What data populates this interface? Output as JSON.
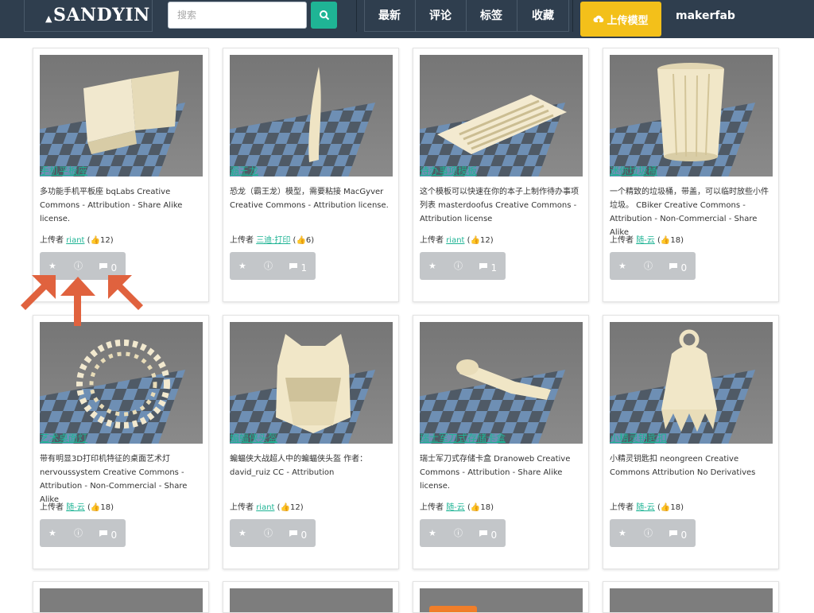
{
  "header": {
    "logo": "SANDYIN",
    "search_placeholder": "搜索",
    "nav": [
      "最新",
      "评论",
      "标签",
      "收藏"
    ],
    "upload_label": "上传模型",
    "makerfab_label": "makerfab"
  },
  "cards": [
    {
      "title": "手机平板座",
      "desc": "多功能手机平板座 bqLabs Creative Commons - Attribution - Share Alike license.",
      "uploader_label": "上传者",
      "uploader": "riant",
      "likes": "12",
      "star": "★",
      "info": "ⓘ",
      "comments": "0",
      "color": "#f3e9c9"
    },
    {
      "title": "霸王龙",
      "desc": "恐龙（霸王龙）模型，需要粘接 MacGyver Creative Commons - Attribution license.",
      "uploader_label": "上传者",
      "uploader": "三迪·打印",
      "likes": "6",
      "star": "★",
      "info": "ⓘ",
      "comments": "1",
      "color": "#f3e9c9"
    },
    {
      "title": "待办事项模板",
      "desc": "这个模板可以快速在你的本子上制作待办事项列表 masterdoofus Creative Commons - Attribution license",
      "uploader_label": "上传者",
      "uploader": "riant",
      "likes": "12",
      "star": "★",
      "info": "ⓘ",
      "comments": "1",
      "color": "#f3e9c9"
    },
    {
      "title": "迷你垃圾桶",
      "desc": "一个精致的垃圾桶，带盖，可以临时放些小件垃圾。 CBiker Creative Commons - Attribution - Non-Commercial - Share Alike",
      "uploader_label": "上传者",
      "uploader": "随-云",
      "likes": "18",
      "star": "★",
      "info": "ⓘ",
      "comments": "0",
      "color": "#f3e9c9"
    },
    {
      "title": "艺术桌面灯",
      "desc": "带有明显3D打印机特征的桌面艺术灯 nervoussystem Creative Commons - Attribution - Non-Commercial - Share Alike",
      "uploader_label": "上传者",
      "uploader": "随-云",
      "likes": "18",
      "star": "★",
      "info": "ⓘ",
      "comments": "0",
      "color": "#f3e9c9"
    },
    {
      "title": "蝙蝠侠头盔",
      "desc": "蝙蝠侠大战超人中的蝙蝠侠头盔 作者：david_ruiz CC - Attribution",
      "uploader_label": "上传者",
      "uploader": "riant",
      "likes": "12",
      "star": "★",
      "info": "ⓘ",
      "comments": "0",
      "color": "#f3e9c9"
    },
    {
      "title": "瑞士军刀式存储卡盒",
      "desc": "瑞士军刀式存储卡盒 Dranoweb Creative Commons - Attribution - Share Alike license.",
      "uploader_label": "上传者",
      "uploader": "随-云",
      "likes": "18",
      "star": "★",
      "info": "ⓘ",
      "comments": "0",
      "color": "#f3e9c9"
    },
    {
      "title": "小精灵钥匙扣",
      "desc": "小精灵钥匙扣 neongreen Creative Commons Attribution No Derivatives",
      "uploader_label": "上传者",
      "uploader": "随-云",
      "likes": "18",
      "star": "★",
      "info": "ⓘ",
      "comments": "0",
      "color": "#f3e9c9"
    }
  ],
  "colors": {
    "nav_bg": "#2f3e4e",
    "accent": "#1fb495",
    "upload_bg": "#f3c01a",
    "action_bg": "#c3c6c9",
    "arrow": "#e0623e"
  }
}
